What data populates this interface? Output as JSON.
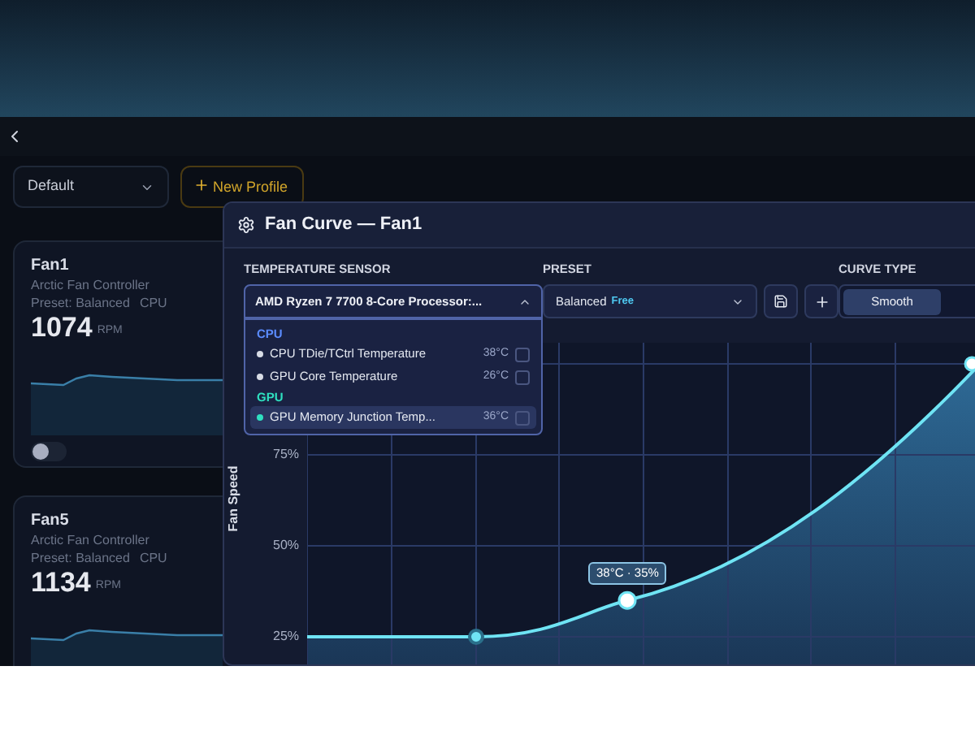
{
  "profile_select": {
    "value": "Default"
  },
  "new_profile_button": {
    "label": "New Profile"
  },
  "fans": [
    {
      "name": "Fan1",
      "controller": "Arctic Fan Controller",
      "preset": "Preset: Balanced",
      "source": "CPU",
      "rpm": "1074",
      "unit": "RPM",
      "enabled": false
    },
    {
      "name": "Fan5",
      "controller": "Arctic Fan Controller",
      "preset": "Preset: Balanced",
      "source": "CPU",
      "rpm": "1134",
      "unit": "RPM"
    }
  ],
  "dialog": {
    "title": "Fan Curve — Fan1",
    "sensor": {
      "label": "TEMPERATURE SENSOR",
      "value": "AMD Ryzen 7 7700 8-Core Processor:...",
      "expanded": true,
      "groups": [
        {
          "name": "CPU",
          "color": "#5b8cff",
          "items": [
            {
              "name": "CPU TDie/TCtrl Temperature",
              "reading": "38°C",
              "selected": false,
              "checked": false
            },
            {
              "name": "GPU Core Temperature",
              "reading": "26°C",
              "selected": false,
              "checked": false
            }
          ]
        },
        {
          "name": "GPU",
          "color": "#2fe0c0",
          "items": [
            {
              "name": "GPU Memory Junction Temp...",
              "reading": "36°C",
              "selected": true,
              "checked": false
            }
          ]
        }
      ]
    },
    "preset": {
      "label": "PRESET",
      "value": "Balanced",
      "tag": "Free"
    },
    "curve_type": {
      "label": "CURVE TYPE",
      "options": [
        {
          "label": "Smooth",
          "selected": true
        }
      ]
    },
    "chart": {
      "y_axis_label": "Fan Speed",
      "y_ticks": [
        "75%",
        "50%",
        "25%"
      ],
      "tooltip": "38°C · 35%"
    }
  }
}
